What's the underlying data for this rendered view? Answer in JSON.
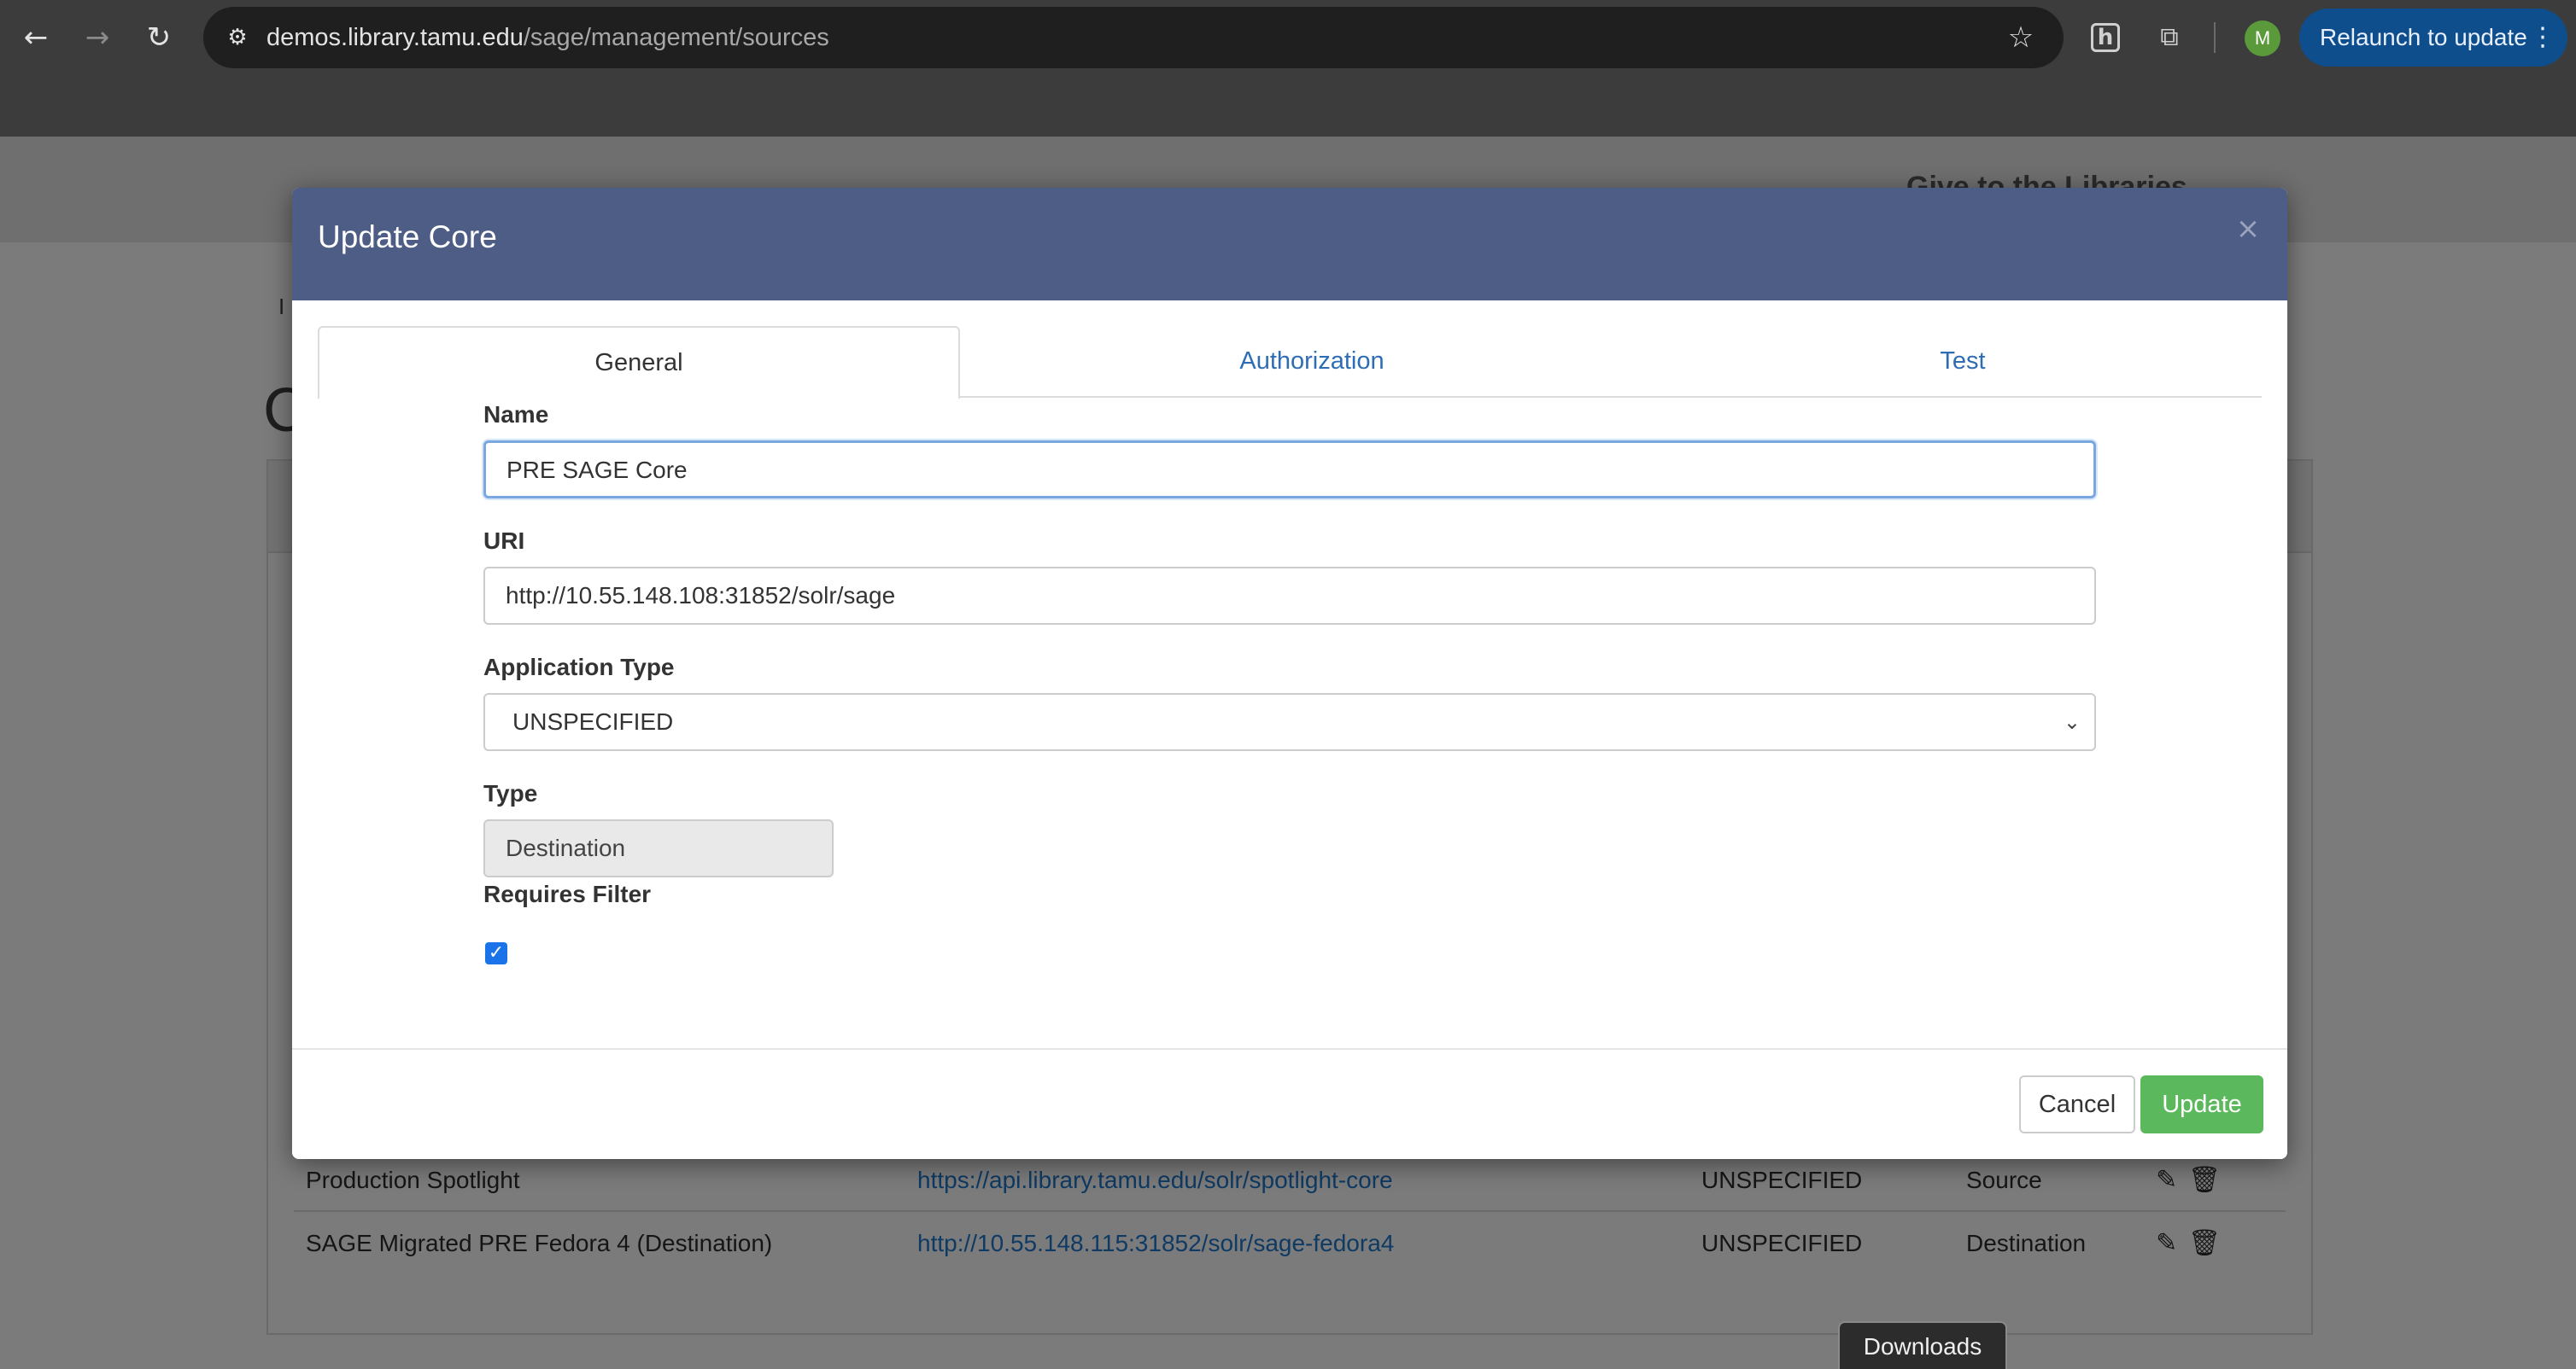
{
  "browser": {
    "url_host": "demos.library.tamu.edu",
    "url_path": "/sage/management/sources",
    "profile_initial": "M",
    "relaunch_label": "Relaunch to update",
    "icons": {
      "back": "back-arrow-icon",
      "forward": "forward-arrow-icon",
      "reload": "reload-icon",
      "site_info": "site-info-icon",
      "bookmark": "star-icon",
      "extension_h": "h-extension-icon",
      "extensions": "puzzle-icon",
      "menu": "vertical-dots-icon"
    }
  },
  "background_page": {
    "header_link": "Give to the Libraries",
    "heading_fragment": "C",
    "breadcrumb_fragment": "I",
    "rows": [
      {
        "name": "Production Spotlight",
        "uri": "https://api.library.tamu.edu/solr/spotlight-core",
        "application_type": "UNSPECIFIED",
        "type": "Source"
      },
      {
        "name": "SAGE Migrated PRE Fedora 4 (Destination)",
        "uri": "http://10.55.148.115:31852/solr/sage-fedora4",
        "application_type": "UNSPECIFIED",
        "type": "Destination"
      }
    ],
    "downloads_label": "Downloads"
  },
  "modal": {
    "title": "Update Core",
    "close_symbol": "×",
    "tabs": [
      {
        "label": "General",
        "active": true
      },
      {
        "label": "Authorization",
        "active": false
      },
      {
        "label": "Test",
        "active": false
      }
    ],
    "fields": {
      "name": {
        "label": "Name",
        "value": "PRE SAGE Core"
      },
      "uri": {
        "label": "URI",
        "value": "http://10.55.148.108:31852/solr/sage"
      },
      "application_type": {
        "label": "Application Type",
        "selected": "UNSPECIFIED"
      },
      "type": {
        "label": "Type",
        "value": "Destination"
      },
      "requires_filter": {
        "label": "Requires Filter",
        "checked": true
      }
    },
    "buttons": {
      "cancel": "Cancel",
      "update": "Update"
    }
  },
  "colors": {
    "modal_header": "#4e5d85",
    "link": "#2e6db4",
    "update_button": "#5cb85c",
    "relaunch_button": "#0f4e8c"
  }
}
